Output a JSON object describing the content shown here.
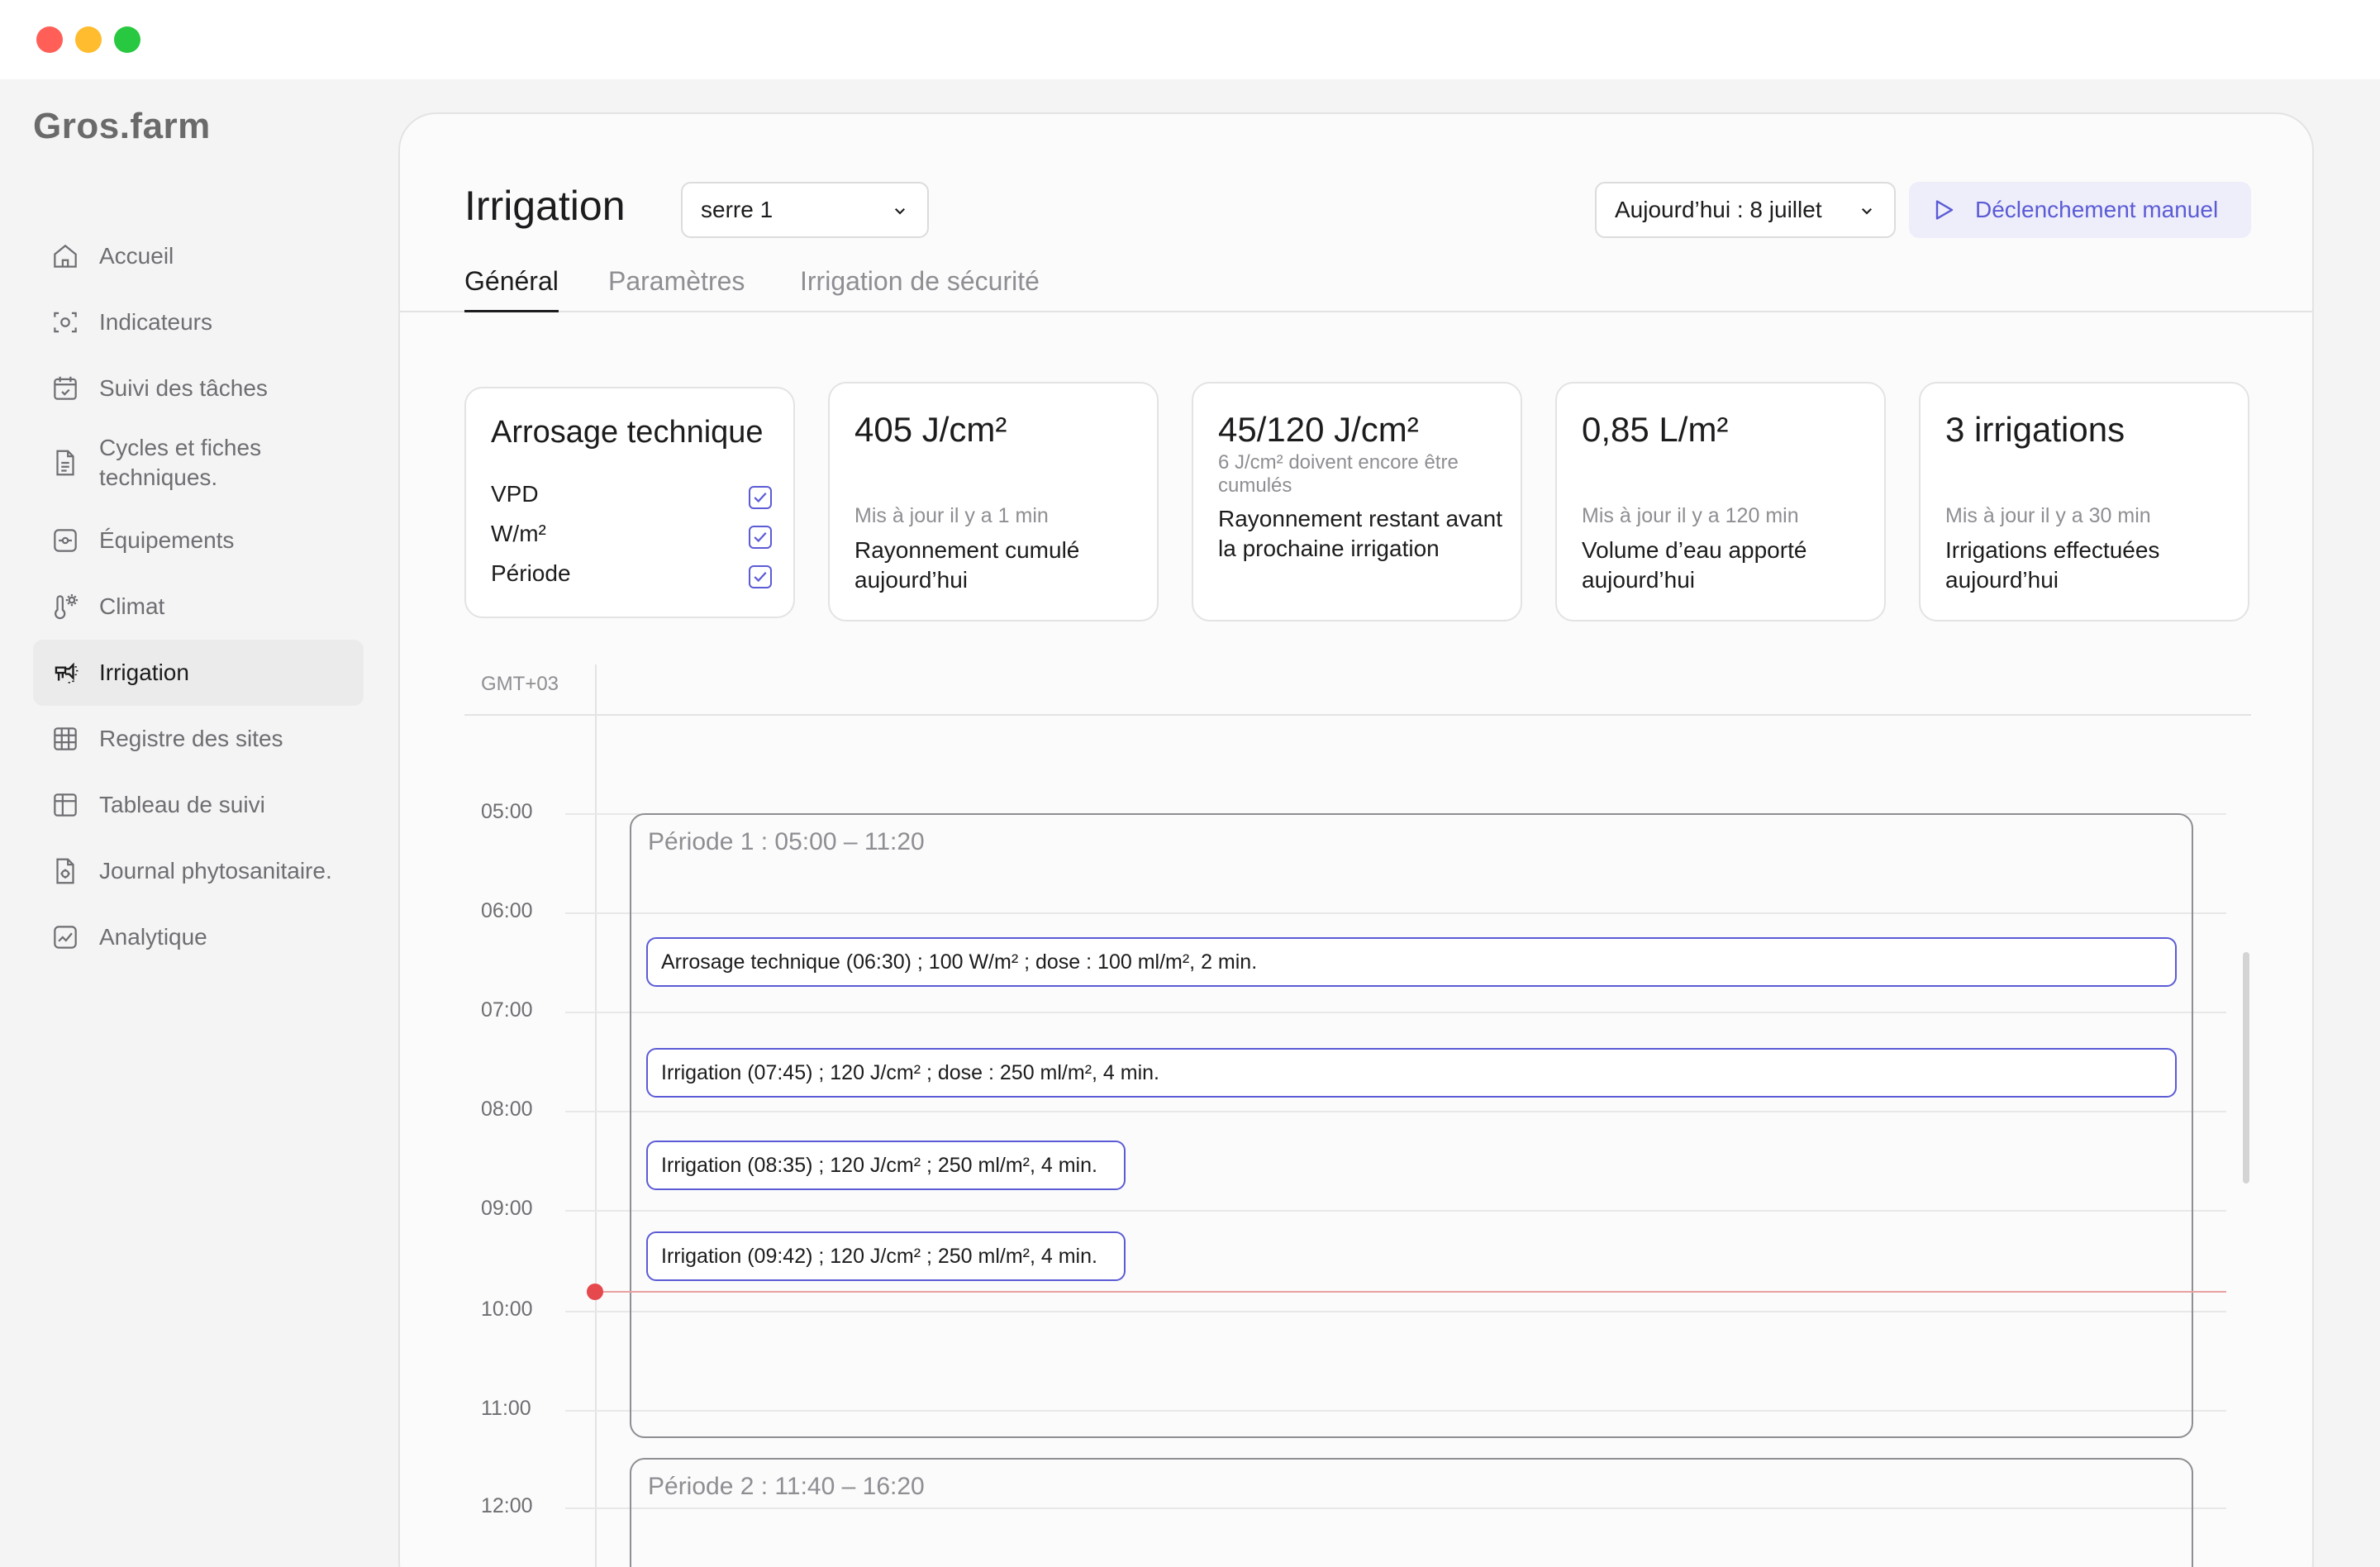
{
  "app": {
    "logo": "Gros.farm"
  },
  "sidebar": {
    "items": [
      {
        "label": "Accueil",
        "icon": "home-icon"
      },
      {
        "label": "Indicateurs",
        "icon": "indicators-icon"
      },
      {
        "label": "Suivi des tâches",
        "icon": "calendar-check-icon"
      },
      {
        "label": "Cycles et fiches techniques.",
        "icon": "document-icon"
      },
      {
        "label": "Équipements",
        "icon": "equipment-icon"
      },
      {
        "label": "Climat",
        "icon": "thermometer-icon"
      },
      {
        "label": "Irrigation",
        "icon": "irrigation-icon",
        "active": true
      },
      {
        "label": "Registre des sites",
        "icon": "grid-icon"
      },
      {
        "label": "Tableau de suivi",
        "icon": "table-icon"
      },
      {
        "label": "Journal phytosanitaire.",
        "icon": "journal-icon"
      },
      {
        "label": "Analytique",
        "icon": "chart-icon"
      }
    ]
  },
  "header": {
    "title": "Irrigation",
    "site_select": "serre 1",
    "date_select": "Aujourd’hui : 8 juillet",
    "manual_button": "Déclenchement manuel"
  },
  "tabs": [
    "Général",
    "Paramètres",
    "Irrigation de sécurité"
  ],
  "tech_card": {
    "title": "Arrosage technique",
    "checks": [
      {
        "label": "VPD",
        "checked": true
      },
      {
        "label": "W/m²",
        "checked": true
      },
      {
        "label": "Période",
        "checked": true
      }
    ]
  },
  "stats": [
    {
      "value": "405 J/cm²",
      "note": "",
      "updated": "Mis à jour il y a 1 min",
      "desc": "Rayonnement cumulé aujourd’hui"
    },
    {
      "value": "45/120 J/cm²",
      "note": "6 J/cm² doivent encore être cumulés",
      "updated": "",
      "desc": "Rayonnement restant avant la prochaine irrigation"
    },
    {
      "value": "0,85 L/m²",
      "note": "",
      "updated": "Mis à jour il y a 120 min",
      "desc": "Volume d’eau apporté aujourd’hui"
    },
    {
      "value": "3 irrigations",
      "note": "",
      "updated": "Mis à jour il y a 30 min",
      "desc": "Irrigations effectuées aujourd’hui"
    }
  ],
  "timeline": {
    "timezone": "GMT+03",
    "hours": [
      "05:00",
      "06:00",
      "07:00",
      "08:00",
      "09:00",
      "10:00",
      "11:00",
      "12:00"
    ],
    "periods": [
      {
        "label": "Période 1 : 05:00 – 11:20"
      },
      {
        "label": "Période 2 : 11:40 – 16:20"
      }
    ],
    "events": [
      "Arrosage technique (06:30) ; 100 W/m² ; dose : 100 ml/m², 2 min.",
      "Irrigation (07:45) ; 120 J/cm² ; dose : 250 ml/m², 4 min.",
      "Irrigation (08:35) ; 120 J/cm² ; 250 ml/m², 4 min.",
      "Irrigation (09:42) ; 120 J/cm² ; 250 ml/m², 4 min."
    ]
  },
  "colors": {
    "accent": "#5b5bd6",
    "now_line": "#e5484d"
  }
}
